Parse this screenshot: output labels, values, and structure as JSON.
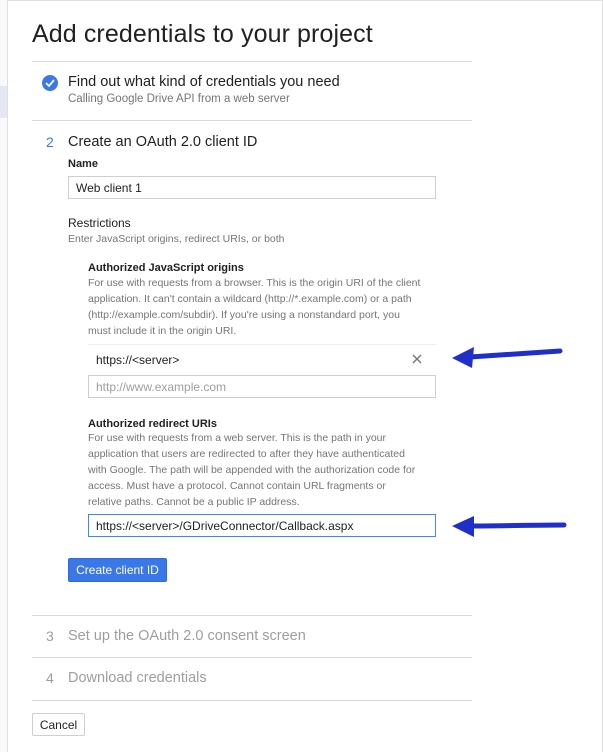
{
  "page": {
    "title": "Add credentials to your project"
  },
  "steps": [
    {
      "number": "",
      "title": "Find out what kind of credentials you need",
      "subtitle": "Calling Google Drive API from a web server",
      "status": "complete"
    },
    {
      "number": "2",
      "title": "Create an OAuth 2.0 client ID",
      "status": "active"
    },
    {
      "number": "3",
      "title": "Set up the OAuth 2.0 consent screen",
      "status": "pending"
    },
    {
      "number": "4",
      "title": "Download credentials",
      "status": "pending"
    }
  ],
  "form": {
    "name_label": "Name",
    "name_value": "Web client 1",
    "restrictions_label": "Restrictions",
    "restrictions_help": "Enter JavaScript origins, redirect URIs, or both",
    "js_origins": {
      "label": "Authorized JavaScript origins",
      "help": [
        "For use with requests from a browser. This is the origin URI of the client",
        "application. It can't contain a wildcard (http://*.example.com) or a path",
        "(http://example.com/subdir). If you're using a nonstandard port, you",
        "must include it in the origin URI."
      ],
      "entries": [
        "https://<server>"
      ],
      "placeholder": "http://www.example.com"
    },
    "redirect_uris": {
      "label": "Authorized redirect URIs",
      "help": [
        "For use with requests from a web server. This is the path in your",
        "application that users are redirected to after they have authenticated",
        "with Google. The path will be appended with the authorization code for",
        "access. Must have a protocol. Cannot contain URL fragments or",
        "relative paths. Cannot be a public IP address."
      ],
      "value": "https://<server>/GDriveConnector/Callback.aspx"
    },
    "create_button_label": "Create client ID"
  },
  "footer": {
    "cancel_label": "Cancel"
  },
  "icons": {
    "step_complete": "check-circle-icon",
    "remove_entry": "close-icon",
    "annotation": "arrow-left-icon"
  },
  "colors": {
    "accent": "#3b78e7",
    "annotation_arrow": "#1f2fc7",
    "muted": "#9e9e9e"
  }
}
